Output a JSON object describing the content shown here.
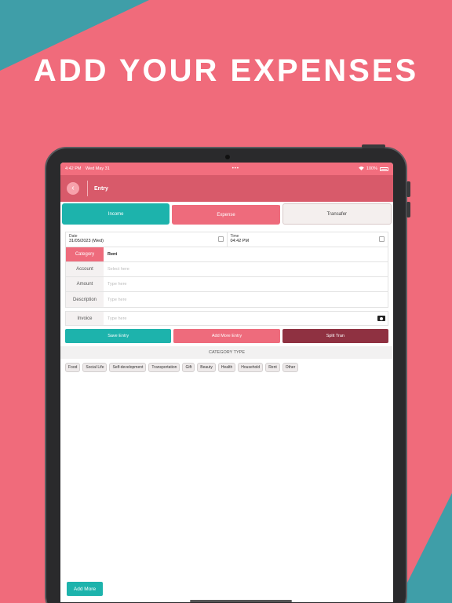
{
  "headline": "ADD YOUR EXPENSES",
  "status_bar": {
    "time": "4:42 PM",
    "date": "Wed May 31",
    "dots": "•••",
    "battery": "100%"
  },
  "nav": {
    "back_icon": "chevron-left-icon",
    "title": "Entry"
  },
  "tabs": [
    {
      "label": "Income"
    },
    {
      "label": "Expense"
    },
    {
      "label": "Transafer"
    }
  ],
  "form": {
    "date_label": "Date",
    "date_value": "31/05/2023 (Wed)",
    "time_label": "Time",
    "time_value": "04:42 PM",
    "category_label": "Category",
    "category_value": "Rent",
    "account_label": "Account",
    "account_placeholder": "Select here",
    "amount_label": "Amount",
    "amount_placeholder": "Type here",
    "description_label": "Description",
    "description_placeholder": "Type here",
    "invoice_label": "Invoice",
    "invoice_placeholder": "Type here"
  },
  "actions": {
    "save": "Save Entry",
    "add_more_entry": "Add More Entry",
    "split": "Split Tran"
  },
  "category_type_title": "CATEGORY TYPE",
  "categories": [
    "Food",
    "Social Life",
    "Self-development",
    "Transportation",
    "Gift",
    "Beauty",
    "Health",
    "Household",
    "Rent",
    "Other"
  ],
  "add_more": "Add More",
  "colors": {
    "background": "#f06b7b",
    "teal": "#1db3ac",
    "pink": "#ee6b7c",
    "maroon": "#8f3141",
    "accent_triangle": "#3f9ea8"
  }
}
